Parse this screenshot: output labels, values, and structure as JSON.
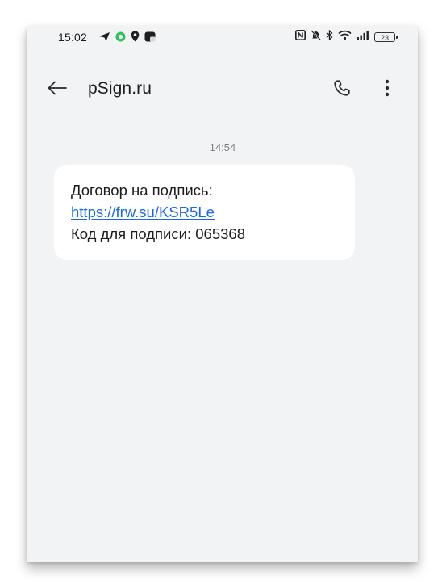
{
  "status_bar": {
    "time": "15:02",
    "battery_level": "23",
    "left_icons": [
      "send-icon",
      "message-bubble-icon",
      "location-pin-icon",
      "notification-card-icon"
    ],
    "right_icons": [
      "nfc-icon",
      "bell-muted-icon",
      "bluetooth-icon",
      "wifi-icon",
      "signal-icon",
      "battery-icon"
    ]
  },
  "app_bar": {
    "title": "pSign.ru",
    "back_icon": "arrow-left-icon",
    "call_icon": "phone-icon",
    "menu_icon": "more-vertical-icon"
  },
  "conversation": {
    "timestamp": "14:54",
    "messages": [
      {
        "line1": "Договор на подпись:",
        "link": "https://frw.su/KSR5Le",
        "line3": "Код для подписи: 065368"
      }
    ]
  },
  "colors": {
    "background": "#f2f3f5",
    "bubble": "#ffffff",
    "link": "#1a6ad8",
    "text": "#1c1c1e",
    "muted": "#7d7f84"
  }
}
